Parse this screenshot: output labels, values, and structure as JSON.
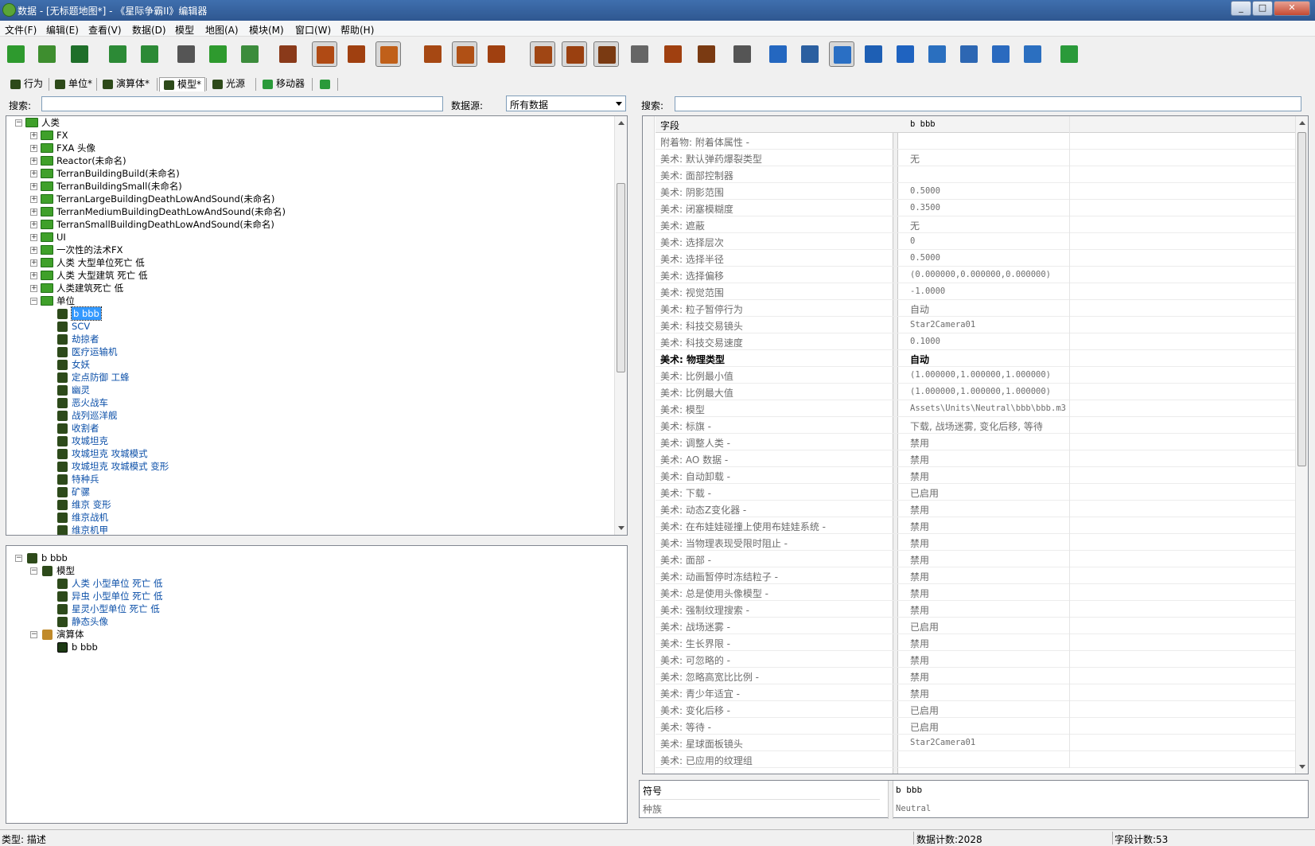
{
  "window": {
    "title": "数据 - [无标题地图*] - 《星际争霸II》编辑器"
  },
  "menu": [
    "文件(F)",
    "编辑(E)",
    "查看(V)",
    "数据(D)",
    "模型",
    "地图(A)",
    "模块(M)",
    "窗口(W)",
    "帮助(H)"
  ],
  "toolbar": {
    "icons": [
      "new-file-icon",
      "open-folder-icon",
      "save-icon",
      "undo-icon",
      "redo-icon",
      "cut-icon",
      "copy-icon",
      "paste-icon",
      "data-scroll-icon",
      "list-icon",
      "unit-icon",
      "model-icon",
      "book-icon",
      "table-icon",
      "listview-icon",
      "stack-icon",
      "panel-icon",
      "scroll-icon",
      "xml-icon",
      "book-icon",
      "code-icon",
      "xml-export-icon",
      "terrain-icon",
      "trigger-gear-icon",
      "unit-editor-icon",
      "text-icon",
      "import-icon",
      "ai-icon",
      "cutscene-icon",
      "film-icon",
      "mod-icon",
      "sc-logo-icon"
    ]
  },
  "tabs": [
    {
      "label": "行为"
    },
    {
      "label": "单位*"
    },
    {
      "label": "演算体*"
    },
    {
      "label": "模型*"
    },
    {
      "label": "光源"
    },
    {
      "label": "移动器"
    }
  ],
  "left": {
    "search_label": "搜索:",
    "source_label": "数据源:",
    "source_value": "所有数据"
  },
  "right": {
    "search_label": "搜索:"
  },
  "tree": [
    {
      "label": "人类",
      "level": 0,
      "type": "folder",
      "open": true
    },
    {
      "label": "FX",
      "level": 1,
      "type": "folder"
    },
    {
      "label": "FXA 头像",
      "level": 1,
      "type": "folder"
    },
    {
      "label": "Reactor(未命名)",
      "level": 1,
      "type": "folder"
    },
    {
      "label": "TerranBuildingBuild(未命名)",
      "level": 1,
      "type": "folder"
    },
    {
      "label": "TerranBuildingSmall(未命名)",
      "level": 1,
      "type": "folder"
    },
    {
      "label": "TerranLargeBuildingDeathLowAndSound(未命名)",
      "level": 1,
      "type": "folder"
    },
    {
      "label": "TerranMediumBuildingDeathLowAndSound(未命名)",
      "level": 1,
      "type": "folder"
    },
    {
      "label": "TerranSmallBuildingDeathLowAndSound(未命名)",
      "level": 1,
      "type": "folder"
    },
    {
      "label": "UI",
      "level": 1,
      "type": "folder"
    },
    {
      "label": "一次性的法术FX",
      "level": 1,
      "type": "folder"
    },
    {
      "label": "人类 大型单位死亡 低",
      "level": 1,
      "type": "folder"
    },
    {
      "label": "人类 大型建筑 死亡 低",
      "level": 1,
      "type": "folder"
    },
    {
      "label": "人类建筑死亡 低",
      "level": 1,
      "type": "folder"
    },
    {
      "label": "单位",
      "level": 1,
      "type": "folder",
      "open": true
    },
    {
      "label": "b bbb",
      "level": 2,
      "type": "unit",
      "selected": true
    },
    {
      "label": "SCV",
      "level": 2,
      "type": "unit"
    },
    {
      "label": "劫掠者",
      "level": 2,
      "type": "unit"
    },
    {
      "label": "医疗运输机",
      "level": 2,
      "type": "unit"
    },
    {
      "label": "女妖",
      "level": 2,
      "type": "unit"
    },
    {
      "label": "定点防御 工蜂",
      "level": 2,
      "type": "unit"
    },
    {
      "label": "幽灵",
      "level": 2,
      "type": "unit"
    },
    {
      "label": "恶火战车",
      "level": 2,
      "type": "unit"
    },
    {
      "label": "战列巡洋舰",
      "level": 2,
      "type": "unit"
    },
    {
      "label": "收割者",
      "level": 2,
      "type": "unit"
    },
    {
      "label": "攻城坦克",
      "level": 2,
      "type": "unit"
    },
    {
      "label": "攻城坦克 攻城模式",
      "level": 2,
      "type": "unit"
    },
    {
      "label": "攻城坦克 攻城模式 变形",
      "level": 2,
      "type": "unit"
    },
    {
      "label": "特种兵",
      "level": 2,
      "type": "unit"
    },
    {
      "label": "矿骡",
      "level": 2,
      "type": "unit"
    },
    {
      "label": "维京 变形",
      "level": 2,
      "type": "unit"
    },
    {
      "label": "维京战机",
      "level": 2,
      "type": "unit"
    },
    {
      "label": "维京机甲",
      "level": 2,
      "type": "unit"
    }
  ],
  "tree2": [
    {
      "label": "b bbb",
      "level": 0,
      "type": "unit",
      "open": true
    },
    {
      "label": "模型",
      "level": 1,
      "type": "unit",
      "open": true
    },
    {
      "label": "人类 小型单位 死亡 低",
      "level": 2,
      "type": "unit"
    },
    {
      "label": "异虫 小型单位 死亡 低",
      "level": 2,
      "type": "unit"
    },
    {
      "label": "星灵小型单位 死亡 低",
      "level": 2,
      "type": "unit"
    },
    {
      "label": "静态头像",
      "level": 2,
      "type": "unit"
    },
    {
      "label": "演算体",
      "level": 1,
      "type": "actor",
      "open": true
    },
    {
      "label": "b bbb",
      "level": 2,
      "type": "actorunit"
    }
  ],
  "grid": {
    "header": {
      "field": "字段",
      "value": "b bbb"
    },
    "rows": [
      {
        "f": "附着物: 附着体属性 -",
        "v": ""
      },
      {
        "f": "美术: 默认弹药爆裂类型",
        "v": "无"
      },
      {
        "f": "美术: 面部控制器",
        "v": ""
      },
      {
        "f": "美术: 阴影范围",
        "v": "0.5000",
        "m": true
      },
      {
        "f": "美术: 闭塞模糊度",
        "v": "0.3500",
        "m": true
      },
      {
        "f": "美术: 遮蔽",
        "v": "无"
      },
      {
        "f": "美术: 选择层次",
        "v": "0",
        "m": true
      },
      {
        "f": "美术: 选择半径",
        "v": "0.5000",
        "m": true
      },
      {
        "f": "美术: 选择偏移",
        "v": "(0.000000,0.000000,0.000000)",
        "m": true
      },
      {
        "f": "美术: 视觉范围",
        "v": "-1.0000",
        "m": true
      },
      {
        "f": "美术: 粒子暂停行为",
        "v": "自动"
      },
      {
        "f": "美术: 科技交易镜头",
        "v": "Star2Camera01",
        "m": true
      },
      {
        "f": "美术: 科技交易速度",
        "v": "0.1000",
        "m": true
      },
      {
        "f": "美术: 物理类型",
        "v": "自动",
        "b": true
      },
      {
        "f": "美术: 比例最小值",
        "v": "(1.000000,1.000000,1.000000)",
        "m": true
      },
      {
        "f": "美术: 比例最大值",
        "v": "(1.000000,1.000000,1.000000)",
        "m": true
      },
      {
        "f": "美术: 模型",
        "v": "Assets\\Units\\Neutral\\bbb\\bbb.m3",
        "m": true
      },
      {
        "f": "美术: 标旗 -",
        "v": "下载, 战场迷雾, 变化后移, 等待"
      },
      {
        "f": "美术:    调整人类 -",
        "v": "禁用"
      },
      {
        "f": "美术:    AO 数据 -",
        "v": "禁用"
      },
      {
        "f": "美术:    自动卸载 -",
        "v": "禁用"
      },
      {
        "f": "美术:    下载 -",
        "v": "已启用"
      },
      {
        "f": "美术:    动态Z变化器 -",
        "v": "禁用"
      },
      {
        "f": "美术:    在布娃娃碰撞上使用布娃娃系统 -",
        "v": "禁用"
      },
      {
        "f": "美术:    当物理表现受限时阻止 -",
        "v": "禁用"
      },
      {
        "f": "美术:    面部 -",
        "v": "禁用"
      },
      {
        "f": "美术:    动画暂停时冻结粒子 -",
        "v": "禁用"
      },
      {
        "f": "美术:    总是使用头像模型 -",
        "v": "禁用"
      },
      {
        "f": "美术:    强制纹理搜索 -",
        "v": "禁用"
      },
      {
        "f": "美术:    战场迷雾 -",
        "v": "已启用"
      },
      {
        "f": "美术:    生长界限 -",
        "v": "禁用"
      },
      {
        "f": "美术:    可忽略的 -",
        "v": "禁用"
      },
      {
        "f": "美术:    忽略高宽比比例 -",
        "v": "禁用"
      },
      {
        "f": "美术:    青少年适宜 -",
        "v": "禁用"
      },
      {
        "f": "美术:    变化后移 -",
        "v": "已启用"
      },
      {
        "f": "美术:    等待 -",
        "v": "已启用"
      },
      {
        "f": "美术: 星球面板镜头",
        "v": "Star2Camera01",
        "m": true
      },
      {
        "f": "美术: 已应用的纹理组",
        "v": ""
      }
    ]
  },
  "symbol": {
    "label1": "符号",
    "value1": "b bbb",
    "label2": "种族",
    "value2": "Neutral"
  },
  "status": {
    "type": "类型: 描述",
    "data_count": "数据计数:2028",
    "field_count": "字段计数:53"
  }
}
